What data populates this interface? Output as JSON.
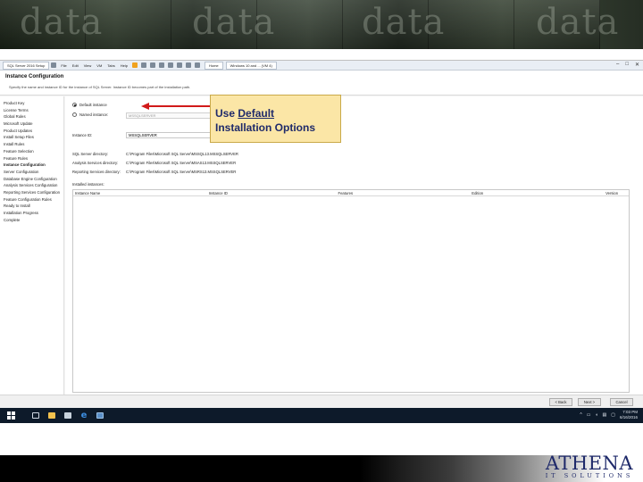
{
  "banner": {
    "word": "data"
  },
  "toolbar": {
    "app_tab": "SQL Server 2016 Setup",
    "menus": [
      "File",
      "Edit",
      "View",
      "VM",
      "Tabs",
      "Help"
    ],
    "home_tab": "Home",
    "vm_tab": "Windows 10 and ... (VM 4)"
  },
  "window_controls": {
    "minimize": "–",
    "maximize": "□",
    "close": "✕"
  },
  "header": {
    "title": "Instance Configuration",
    "subtitle": "Specify the name and instance ID for the instance of SQL Server. Instance ID becomes part of the installation path."
  },
  "sidebar": {
    "items": [
      "Product Key",
      "License Terms",
      "Global Rules",
      "Microsoft Update",
      "Product Updates",
      "Install Setup Files",
      "Install Rules",
      "Feature Selection",
      "Feature Rules",
      "Instance Configuration",
      "Server Configuration",
      "Database Engine Configuration",
      "Analysis Services Configuration",
      "Reporting Services Configuration",
      "Feature Configuration Rules",
      "Ready to Install",
      "Installation Progress",
      "Complete"
    ],
    "active_index": 9
  },
  "instance_options": {
    "default_label": "Default instance",
    "named_label": "Named instance:",
    "named_placeholder": "MSSQLSERVER"
  },
  "instance_id": {
    "label": "Instance ID:",
    "value": "MSSQLSERVER"
  },
  "directories": [
    {
      "label": "SQL Server directory:",
      "value": "C:\\Program Files\\Microsoft SQL Server\\MSSQL13.MSSQLSERVER"
    },
    {
      "label": "Analysis Services directory:",
      "value": "C:\\Program Files\\Microsoft SQL Server\\MSAS13.MSSQLSERVER"
    },
    {
      "label": "Reporting Services directory:",
      "value": "C:\\Program Files\\Microsoft SQL Server\\MSRS13.MSSQLSERVER"
    }
  ],
  "installed_instances": {
    "label": "Installed instances:",
    "columns": [
      "Instance Name",
      "Instance ID",
      "Features",
      "Edition",
      "Version"
    ]
  },
  "footer": {
    "back": "< Back",
    "next": "Next >",
    "cancel": "Cancel"
  },
  "taskbar": {
    "clock_time": "7:03 PM",
    "clock_date": "6/16/2016"
  },
  "callout": {
    "prefix": "Use ",
    "underlined": "Default",
    "line2": "Installation Options"
  },
  "logo": {
    "name": "ATHENA",
    "tagline": "IT SOLUTIONS"
  }
}
